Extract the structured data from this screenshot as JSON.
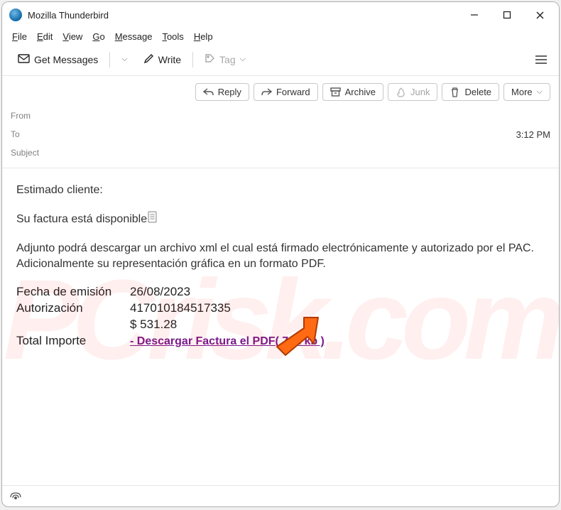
{
  "window": {
    "title": "Mozilla Thunderbird"
  },
  "menu": {
    "file": "File",
    "edit": "Edit",
    "view": "View",
    "go": "Go",
    "message": "Message",
    "tools": "Tools",
    "help": "Help"
  },
  "toolbar": {
    "get_messages": "Get Messages",
    "write": "Write",
    "tag": "Tag"
  },
  "actions": {
    "reply": "Reply",
    "forward": "Forward",
    "archive": "Archive",
    "junk": "Junk",
    "delete": "Delete",
    "more": "More"
  },
  "headers": {
    "from_label": "From",
    "to_label": "To",
    "subject_label": "Subject",
    "time": "3:12 PM"
  },
  "email": {
    "greeting": "Estimado cliente:",
    "line1": "Su factura está disponible",
    "body": "Adjunto podrá descargar un archivo xml el cual está firmado electrónicamente y autorizado por el PAC. Adicionalmente su representación gráfica en un formato PDF.",
    "fecha_label": "Fecha de emisión",
    "fecha_val": "26/08/2023",
    "auth_label": "Autorización",
    "auth_val": "417010184517335",
    "amount": "$ 531.28",
    "total_label": "Total Importe",
    "download_link": "- Descargar Factura el PDF( 732 kb )"
  },
  "status": {
    "icon": "((○))"
  },
  "watermark": "PCrisk.com"
}
